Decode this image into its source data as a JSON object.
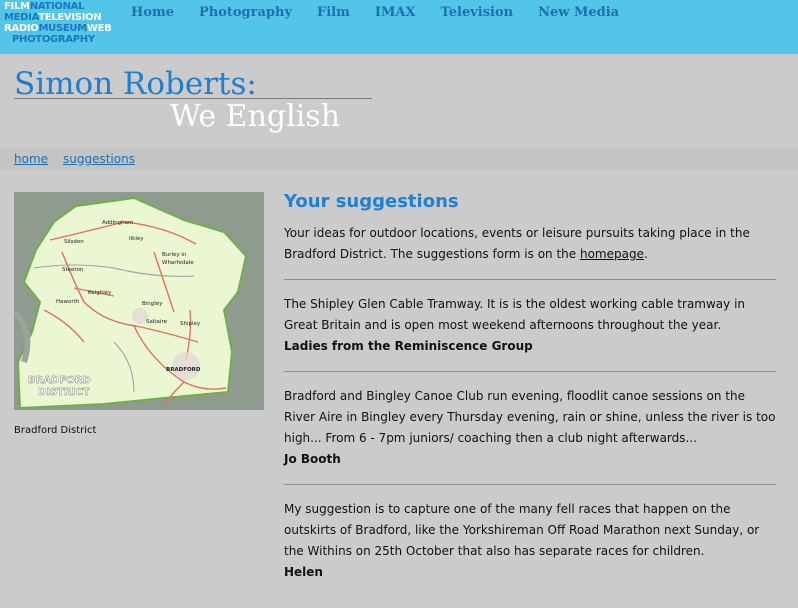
{
  "logo": {
    "line1a": "FILM",
    "line1b": "NATIONAL",
    "line2a": "MEDIA",
    "line2b": "TELEVISION",
    "line3a": "RADIO",
    "line3b": "MUSEUM",
    "line3c": "WEB",
    "line4": "PHOTOGRAPHY"
  },
  "nav": {
    "items": [
      "Home",
      "Photography",
      "Film",
      "IMAX",
      "Television",
      "New Media"
    ]
  },
  "header": {
    "title": "Simon Roberts:",
    "subtitle": "We English"
  },
  "breadcrumb": {
    "home": "home",
    "suggestions": "suggestions"
  },
  "map": {
    "caption": "Bradford District",
    "label_district_1": "BRADFORD",
    "label_district_2": "DISTRICT",
    "places": [
      "Addingham",
      "Ilkley",
      "Silsden",
      "Burley in",
      "Wharfedale",
      "Steeton",
      "Keighley",
      "Haworth",
      "Bingley",
      "Saltaire",
      "Shipley",
      "BRADFORD"
    ]
  },
  "content": {
    "heading": "Your suggestions",
    "intro_before": "Your ideas for outdoor locations, events or leisure pursuits taking place in the Bradford District. The suggestions form is on the ",
    "intro_link": "homepage",
    "intro_after": ".",
    "suggestions": [
      {
        "text": "The Shipley Glen Cable Tramway. It is is the oldest working cable tramway in Great Britain and is open most weekend afternoons throughout the year.",
        "author": "Ladies from the Reminiscence Group"
      },
      {
        "text": "Bradford and Bingley Canoe Club run evening, floodlit canoe sessions on the River Aire in Bingley every Thursday evening, rain or shine, unless the river is too high... From 6 - 7pm juniors/ coaching then a club night afterwards...",
        "author": "Jo Booth"
      },
      {
        "text": "My suggestion is to capture one of the many fell races that happen on the outskirts of Bradford, like the Yorkshireman Off Road Marathon next Sunday, or the Withins on 25th October that also has separate races for children.",
        "author": "Helen"
      }
    ]
  }
}
